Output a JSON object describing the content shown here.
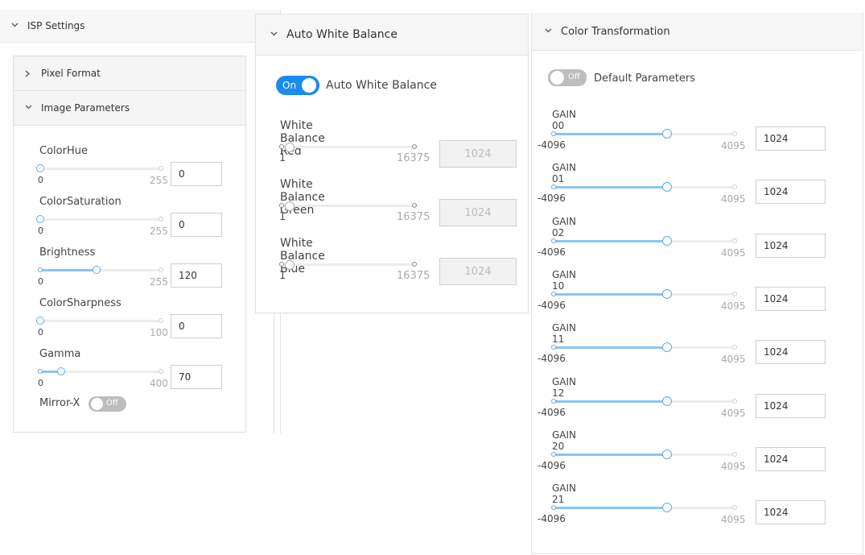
{
  "isp": {
    "title": "ISP Settings",
    "pixel_format": "Pixel Format",
    "image_parameters": "Image Parameters",
    "params": [
      {
        "label": "ColorHue",
        "min": "0",
        "max": "255",
        "value": "0"
      },
      {
        "label": "ColorSaturation",
        "min": "0",
        "max": "255",
        "value": "0"
      },
      {
        "label": "Brightness",
        "min": "0",
        "max": "255",
        "value": "120"
      },
      {
        "label": "ColorSharpness",
        "min": "0",
        "max": "100",
        "value": "0"
      },
      {
        "label": "Gamma",
        "min": "0",
        "max": "400",
        "value": "70"
      }
    ],
    "mirror_label": "Mirror-X",
    "mirror_state": "Off"
  },
  "awb": {
    "title": "Auto White Balance",
    "toggle_state": "On",
    "toggle_label": "Auto White Balance",
    "params": [
      {
        "label": "White Balance Red",
        "min": "1",
        "max": "16375",
        "value": "1024"
      },
      {
        "label": "White Balance Green",
        "min": "1",
        "max": "16375",
        "value": "1024"
      },
      {
        "label": "White Balance Blue",
        "min": "1",
        "max": "16375",
        "value": "1024"
      }
    ]
  },
  "ct": {
    "title": "Color Transformation",
    "default_state": "Off",
    "default_label": "Default Parameters",
    "gains": [
      {
        "label": "GAIN 00",
        "min": "-4096",
        "max": "4095",
        "value": "1024"
      },
      {
        "label": "GAIN 01",
        "min": "-4096",
        "max": "4095",
        "value": "1024"
      },
      {
        "label": "GAIN 02",
        "min": "-4096",
        "max": "4095",
        "value": "1024"
      },
      {
        "label": "GAIN 10",
        "min": "-4096",
        "max": "4095",
        "value": "1024"
      },
      {
        "label": "GAIN 11",
        "min": "-4096",
        "max": "4095",
        "value": "1024"
      },
      {
        "label": "GAIN 12",
        "min": "-4096",
        "max": "4095",
        "value": "1024"
      },
      {
        "label": "GAIN 20",
        "min": "-4096",
        "max": "4095",
        "value": "1024"
      },
      {
        "label": "GAIN 21",
        "min": "-4096",
        "max": "4095",
        "value": "1024"
      }
    ]
  },
  "colors": {
    "accent": "#1a8cef",
    "slider_fill": "#8bc4f0",
    "toggle_off": "#bdbdbd"
  }
}
